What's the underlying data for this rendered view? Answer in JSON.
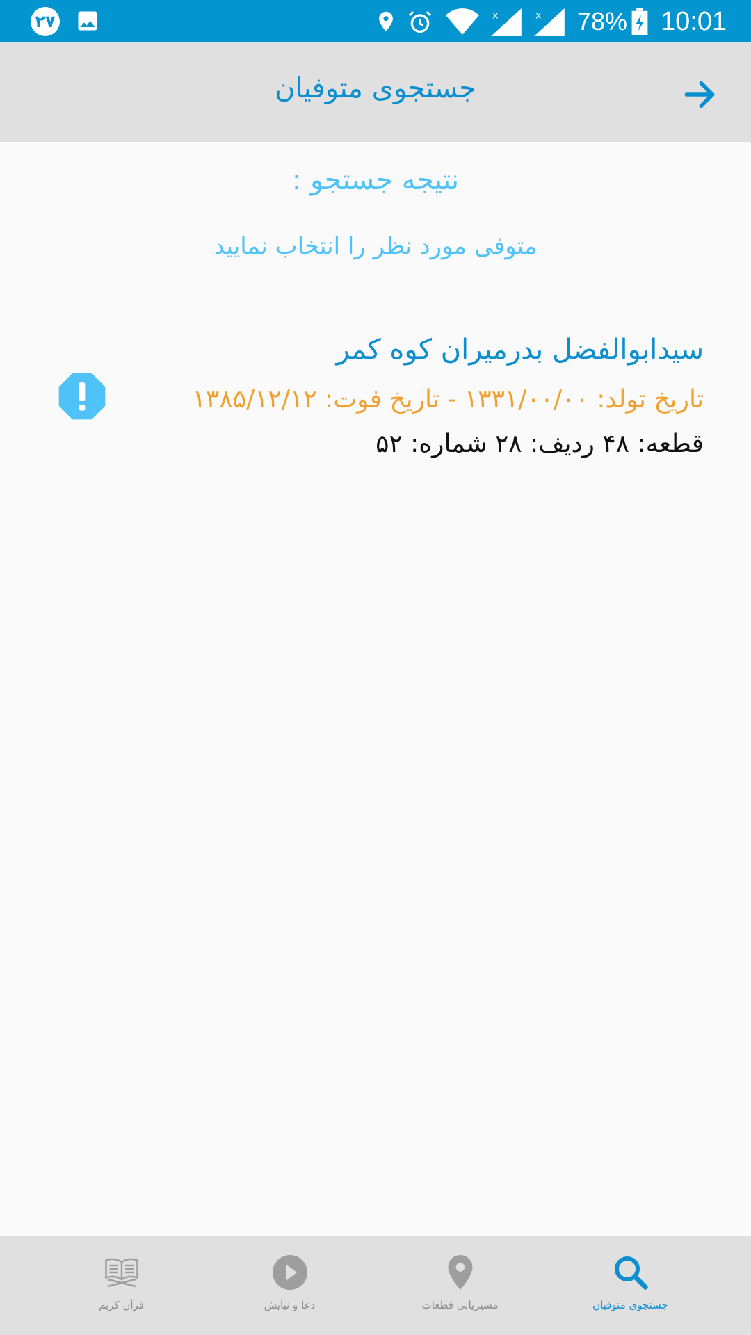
{
  "status_bar": {
    "badge": "۲۷",
    "battery": "78%",
    "time": "10:01"
  },
  "app_bar": {
    "title": "جستجوی متوفیان"
  },
  "content": {
    "heading": "نتیجه جستجو :",
    "hint": "متوفی مورد نظر را انتخاب نمایید",
    "results": [
      {
        "name": "سیدابوالفضل بدرمیران کوه کمر",
        "dates": "تاریخ تولد: ۱۳۳۱/۰۰/۰۰ - تاریخ فوت: ۱۳۸۵/۱۲/۱۲",
        "location": "قطعه: ۴۸ ردیف: ۲۸ شماره: ۵۲"
      }
    ]
  },
  "bottom_nav": {
    "items": [
      {
        "label": "جستجوی متوفیان",
        "icon": "search-icon",
        "active": true
      },
      {
        "label": "مسیریابی قطعات",
        "icon": "location-pin-icon",
        "active": false
      },
      {
        "label": "دعا و نیایش",
        "icon": "play-icon",
        "active": false
      },
      {
        "label": "قرآن کریم",
        "icon": "quran-book-icon",
        "active": false
      }
    ]
  },
  "colors": {
    "status_bar": "#0395d0",
    "app_bar": "#e0e0e0",
    "primary": "#0d8fcf",
    "accent_light": "#4fc3f7",
    "dates": "#f0a030"
  }
}
